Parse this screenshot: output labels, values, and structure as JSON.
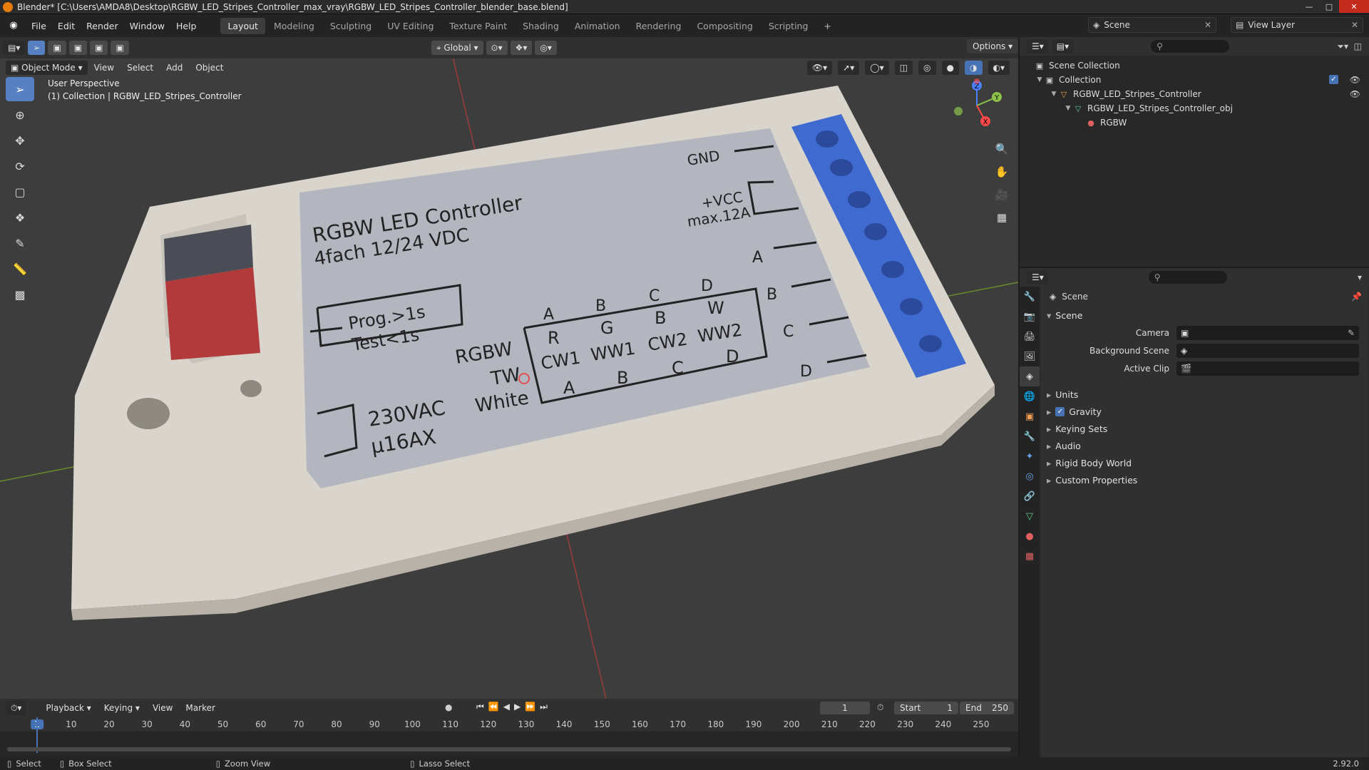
{
  "window": {
    "title": "Blender* [C:\\Users\\AMDA8\\Desktop\\RGBW_LED_Stripes_Controller_max_vray\\RGBW_LED_Stripes_Controller_blender_base.blend]"
  },
  "menubar": {
    "menus": [
      "File",
      "Edit",
      "Render",
      "Window",
      "Help"
    ],
    "workspaces": [
      "Layout",
      "Modeling",
      "Sculpting",
      "UV Editing",
      "Texture Paint",
      "Shading",
      "Animation",
      "Rendering",
      "Compositing",
      "Scripting"
    ],
    "active_workspace": "Layout",
    "scene": "Scene",
    "view_layer": "View Layer"
  },
  "viewport": {
    "mode": "Object Mode",
    "menus": [
      "View",
      "Select",
      "Add",
      "Object"
    ],
    "transform_orientation": "Global",
    "options_label": "Options",
    "info_line1": "User Perspective",
    "info_line2": "(1) Collection | RGBW_LED_Stripes_Controller",
    "tools": [
      "select-box-icon",
      "cursor-icon",
      "move-icon",
      "rotate-icon",
      "scale-icon",
      "transform-icon",
      "annotate-icon",
      "measure-icon",
      "add-cube-icon"
    ],
    "gizmo_axes": [
      "X",
      "Y",
      "Z"
    ]
  },
  "model_label": {
    "title": "RGBW LED Controller",
    "subtitle": "4fach 12/24 VDC",
    "prog": "Prog.>1s",
    "test": "Test<1s",
    "voltage": "230VAC",
    "current": "µ16AX",
    "gnd": "GND",
    "vcc": "+VCC",
    "max": "max.12A",
    "terminals": [
      "A",
      "B",
      "C",
      "D"
    ],
    "table_headers": [
      "A",
      "B",
      "C",
      "D"
    ],
    "row_labels": [
      "RGBW",
      "TW",
      "White"
    ],
    "rows": [
      [
        "R",
        "G",
        "B",
        "W"
      ],
      [
        "CW1",
        "WW1",
        "CW2",
        "WW2"
      ],
      [
        "A",
        "B",
        "C",
        "D"
      ]
    ]
  },
  "outliner": {
    "items": [
      {
        "label": "Scene Collection",
        "depth": 0
      },
      {
        "label": "Collection",
        "depth": 1
      },
      {
        "label": "RGBW_LED_Stripes_Controller",
        "depth": 2
      },
      {
        "label": "RGBW_LED_Stripes_Controller_obj",
        "depth": 3
      },
      {
        "label": "RGBW",
        "depth": 4
      }
    ]
  },
  "properties": {
    "breadcrumb": "Scene",
    "section": "Scene",
    "fields": [
      {
        "label": "Camera",
        "value": ""
      },
      {
        "label": "Background Scene",
        "value": ""
      },
      {
        "label": "Active Clip",
        "value": ""
      }
    ],
    "panels": [
      "Units",
      "Gravity",
      "Keying Sets",
      "Audio",
      "Rigid Body World",
      "Custom Properties"
    ],
    "gravity_checked": true
  },
  "timeline": {
    "menus": [
      "Playback",
      "Keying",
      "View",
      "Marker"
    ],
    "current_frame": "1",
    "start_label": "Start",
    "start": "1",
    "end_label": "End",
    "end": "250",
    "ticks": [
      "1",
      "10",
      "20",
      "30",
      "40",
      "50",
      "60",
      "70",
      "80",
      "90",
      "100",
      "110",
      "120",
      "130",
      "140",
      "150",
      "160",
      "170",
      "180",
      "190",
      "200",
      "210",
      "220",
      "230",
      "240",
      "250"
    ]
  },
  "statusbar": {
    "select": "Select",
    "box_select": "Box Select",
    "zoom_view": "Zoom View",
    "lasso_select": "Lasso Select",
    "version": "2.92.0"
  },
  "colors": {
    "accent": "#4772b3",
    "terminal_blue": "#3f6bd1",
    "housing": "#d9d4cc",
    "label_plate": "#b4b6bf",
    "button_red": "#b23a3a",
    "grid_x": "#9a3c3c",
    "grid_y": "#6a8a2a"
  }
}
